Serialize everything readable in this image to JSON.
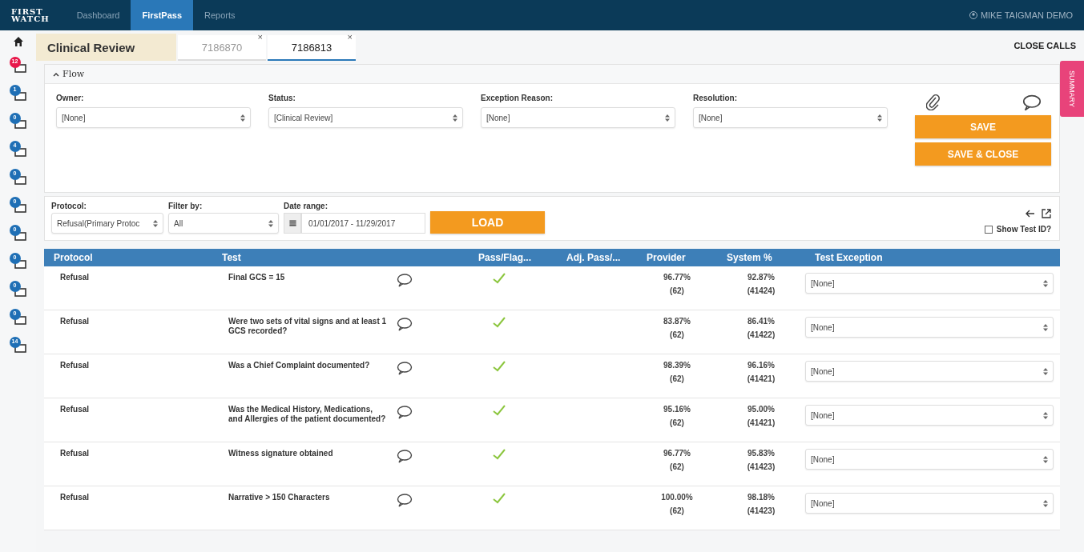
{
  "nav": {
    "logo_top": "FIRST",
    "logo_bottom": "WATCH",
    "items": [
      {
        "label": "Dashboard",
        "selected": false
      },
      {
        "label": "FirstPass",
        "selected": true
      },
      {
        "label": "Reports",
        "selected": false
      }
    ],
    "user": "MIKE TAIGMAN DEMO"
  },
  "sidebar": {
    "badges": [
      {
        "count": "12",
        "color": "#e8174a"
      },
      {
        "count": "1",
        "color": "#1f6fb5"
      },
      {
        "count": "0",
        "color": "#1f6fb5"
      },
      {
        "count": "4",
        "color": "#1f6fb5"
      },
      {
        "count": "0",
        "color": "#1f6fb5"
      },
      {
        "count": "0",
        "color": "#1f6fb5"
      },
      {
        "count": "0",
        "color": "#1f6fb5"
      },
      {
        "count": "0",
        "color": "#1f6fb5"
      },
      {
        "count": "0",
        "color": "#1f6fb5"
      },
      {
        "count": "0",
        "color": "#1f6fb5"
      },
      {
        "count": "14",
        "color": "#1f6fb5"
      }
    ]
  },
  "header": {
    "title": "Clinical Review",
    "tabs": [
      {
        "label": "7186870",
        "close": "×",
        "selected": false
      },
      {
        "label": "7186813",
        "close": "×",
        "selected": true
      }
    ],
    "close_calls": "CLOSE CALLS"
  },
  "summary_tab": "SUMMARY",
  "flow": {
    "title": "Flow",
    "expanded": true,
    "fields": [
      {
        "label": "Owner:",
        "value": "[None]"
      },
      {
        "label": "Status:",
        "value": "[Clinical Review]"
      },
      {
        "label": "Exception Reason:",
        "value": "[None]"
      },
      {
        "label": "Resolution:",
        "value": "[None]"
      }
    ],
    "buttons": [
      "SAVE",
      "SAVE & CLOSE"
    ]
  },
  "filters": {
    "protocol": {
      "label": "Protocol:",
      "value": "Refusal(Primary Protoc"
    },
    "filter_by": {
      "label": "Filter by:",
      "value": "All"
    },
    "date_range": {
      "label": "Date range:",
      "value": "01/01/2017 - 11/29/2017"
    },
    "load": "LOAD",
    "show_test_id": {
      "label": "Show Test ID?",
      "checked": false
    }
  },
  "table": {
    "columns": [
      "Protocol",
      "Test",
      "Pass/Flag...",
      "Adj. Pass/...",
      "Provider",
      "System %",
      "Test Exception"
    ],
    "rows": [
      {
        "protocol": "Refusal",
        "test": "Final GCS = 15",
        "passed": true,
        "provider": "96.77%",
        "provider_n": "(62)",
        "system": "92.87%",
        "system_n": "(41424)",
        "exception": "[None]"
      },
      {
        "protocol": "Refusal",
        "test": "Were two sets of vital signs and at least 1 GCS recorded?",
        "passed": true,
        "provider": "83.87%",
        "provider_n": "(62)",
        "system": "86.41%",
        "system_n": "(41422)",
        "exception": "[None]"
      },
      {
        "protocol": "Refusal",
        "test": "Was a Chief Complaint documented?",
        "passed": true,
        "provider": "98.39%",
        "provider_n": "(62)",
        "system": "96.16%",
        "system_n": "(41421)",
        "exception": "[None]"
      },
      {
        "protocol": "Refusal",
        "test": "Was the Medical History, Medications, and Allergies of the patient documented?",
        "passed": true,
        "provider": "95.16%",
        "provider_n": "(62)",
        "system": "95.00%",
        "system_n": "(41421)",
        "exception": "[None]"
      },
      {
        "protocol": "Refusal",
        "test": "Witness signature obtained",
        "passed": true,
        "provider": "96.77%",
        "provider_n": "(62)",
        "system": "95.83%",
        "system_n": "(41423)",
        "exception": "[None]"
      },
      {
        "protocol": "Refusal",
        "test": "Narrative > 150 Characters",
        "passed": true,
        "provider": "100.00%",
        "provider_n": "(62)",
        "system": "98.18%",
        "system_n": "(41423)",
        "exception": "[None]"
      }
    ]
  }
}
